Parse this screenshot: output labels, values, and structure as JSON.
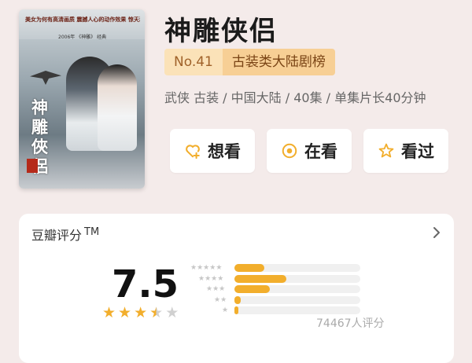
{
  "poster": {
    "tagline": "美女为何有高清画质 震撼人心的动作效果 惊天动地的生死恋情",
    "year": "2006年 《神雕》 经典",
    "calligraphy": "神雕俠侶"
  },
  "title": "神雕侠侣",
  "rank": {
    "number": "No.41",
    "list": "古装类大陆剧榜"
  },
  "meta": "武侠 古装 / 中国大陆 / 40集 / 单集片长40分钟",
  "actions": [
    {
      "label": "想看",
      "icon": "heart-plus-icon"
    },
    {
      "label": "在看",
      "icon": "target-circle-icon"
    },
    {
      "label": "看过",
      "icon": "star-icon"
    }
  ],
  "rating": {
    "title": "豆瓣评分",
    "tm": "TM",
    "score": "7.5",
    "stars_filled": 3.5,
    "stars_total": 5,
    "distribution": [
      {
        "stars": 5,
        "fraction": 0.24
      },
      {
        "stars": 4,
        "fraction": 0.41
      },
      {
        "stars": 3,
        "fraction": 0.28
      },
      {
        "stars": 2,
        "fraction": 0.05
      },
      {
        "stars": 1,
        "fraction": 0.03
      }
    ],
    "count_text": "74467人评分"
  },
  "colors": {
    "accent": "#f2ae2c",
    "rank_bg": "#fbe2b8",
    "rank_list_bg": "#f7cf95",
    "page_bg": "#f4ebea"
  }
}
